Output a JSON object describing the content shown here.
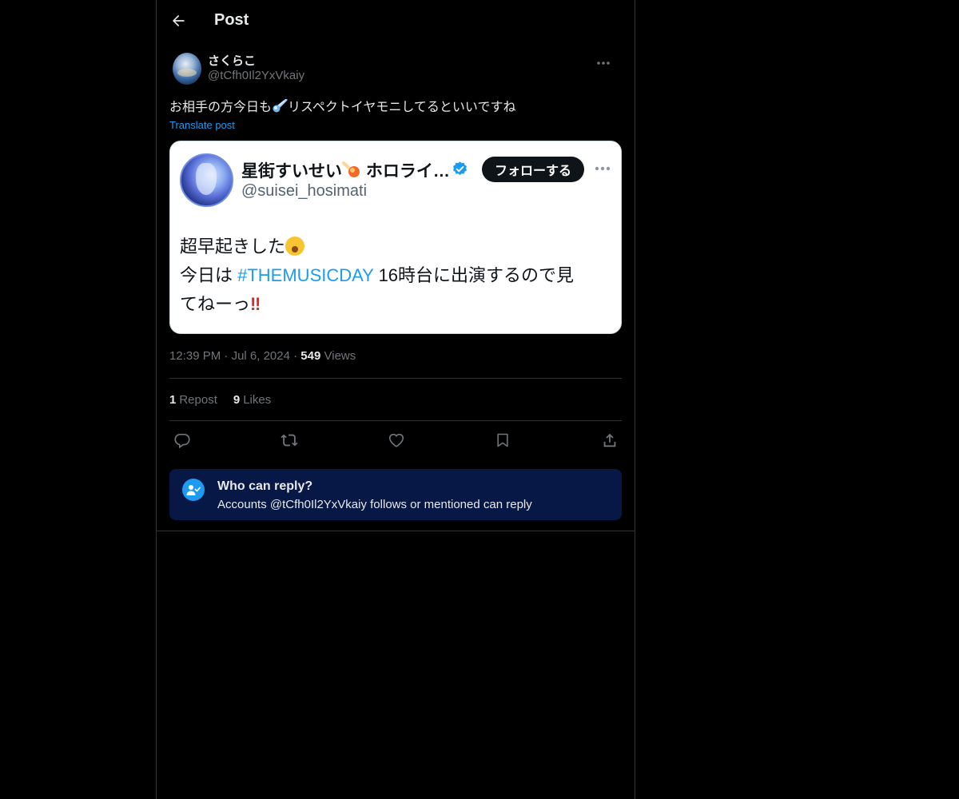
{
  "header": {
    "title": "Post",
    "back_icon": "arrow-left-icon"
  },
  "post": {
    "display_name": "さくらこ",
    "handle": "@tCfh0Il2YxVkaiy",
    "text_before_emoji": "お相手の方今日も",
    "text_after_emoji": "リスペクトイヤモニしてるといいですね",
    "inline_emoji": "comet-emoji",
    "translate_label": "Translate post",
    "time": "12:39 PM",
    "date": "Jul 6, 2024",
    "views_count": "549",
    "views_label": "Views",
    "reposts_count": "1",
    "reposts_label": "Repost",
    "likes_count": "9",
    "likes_label": "Likes"
  },
  "embed": {
    "name": "星街すいせい",
    "name_suffix": "ホロライ…",
    "handle": "@suisei_hosimati",
    "follow_label": "フォローする",
    "line1": "超早起きした",
    "line2_prefix": "今日は ",
    "hashtag": "#THEMUSICDAY",
    "line2_suffix": " 16時台に出演するので見",
    "line3": "てねーっ",
    "bangs": "‼"
  },
  "reply_notice": {
    "title": "Who can reply?",
    "description": "Accounts @tCfh0Il2YxVkaiy follows or mentioned can reply"
  },
  "colors": {
    "background": "#000000",
    "accent": "#1d9bf0",
    "secondary_text": "#71767b",
    "reply_box": "#081846"
  }
}
